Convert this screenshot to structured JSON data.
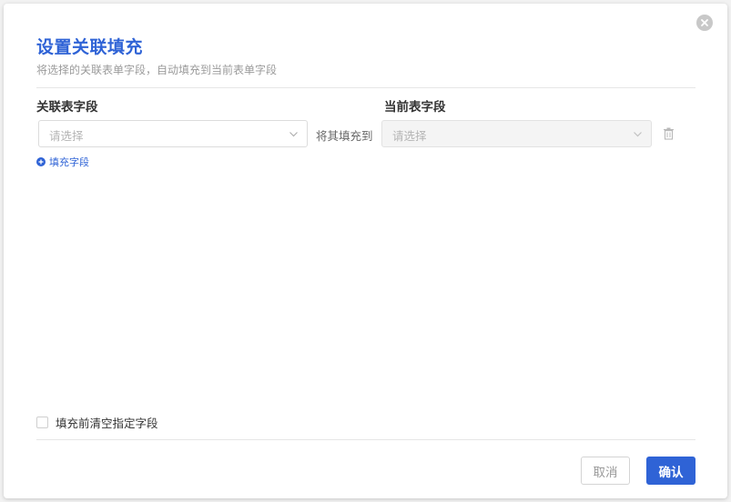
{
  "dialog": {
    "title": "设置关联填充",
    "subtitle": "将选择的关联表单字段，自动填充到当前表单字段"
  },
  "columns": {
    "source_header": "关联表字段",
    "target_header": "当前表字段"
  },
  "mapping_row": {
    "source_placeholder": "请选择",
    "connector_text": "将其填充到",
    "target_placeholder": "请选择",
    "target_disabled": true
  },
  "add_field_label": "填充字段",
  "clear_option": {
    "label": "填充前清空指定字段",
    "checked": false
  },
  "footer": {
    "cancel_label": "取消",
    "confirm_label": "确认"
  },
  "colors": {
    "accent": "#2f63d6",
    "muted_text": "#9a9a9a",
    "border": "#dcdcdc"
  },
  "icons": [
    "close-icon",
    "chevron-down-icon",
    "trash-icon",
    "plus-circle-icon"
  ]
}
